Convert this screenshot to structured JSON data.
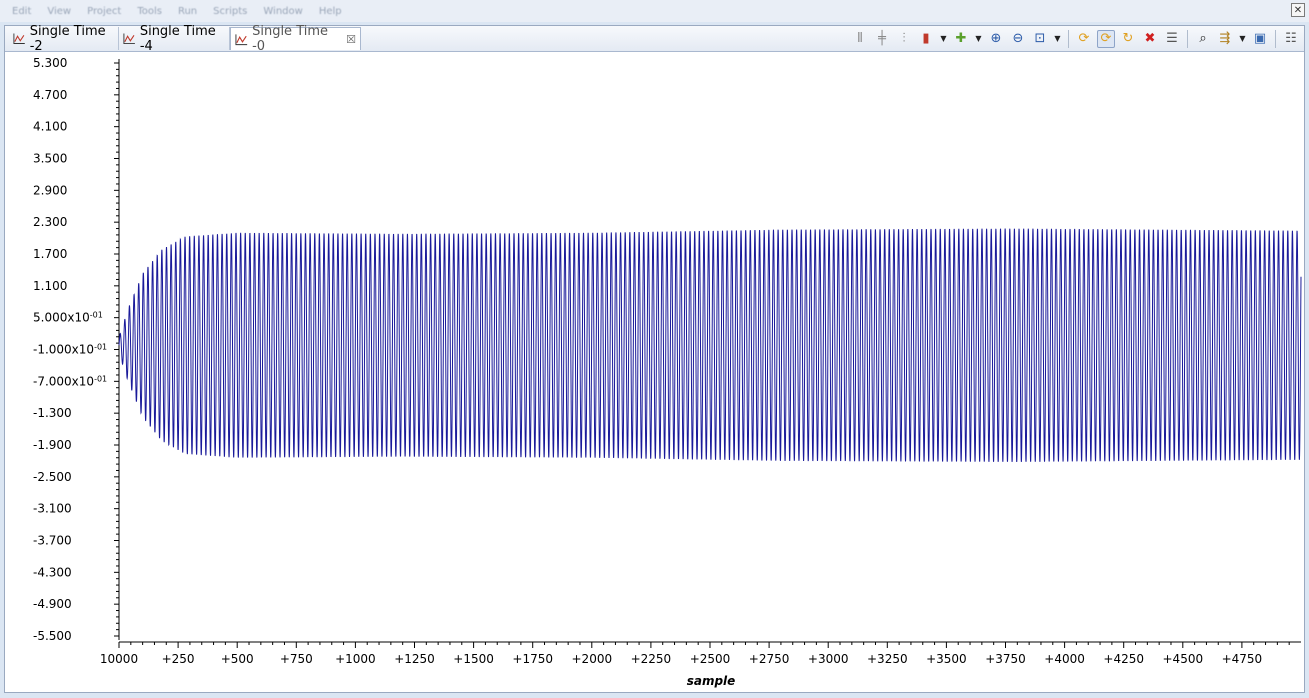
{
  "menubar": [
    "Edit",
    "View",
    "Project",
    "Tools",
    "Run",
    "Scripts",
    "Window",
    "Help"
  ],
  "tabs": [
    {
      "label": "Single Time -2",
      "active": false
    },
    {
      "label": "Single Time -4",
      "active": false
    },
    {
      "label": "Single Time -0",
      "active": true
    }
  ],
  "toolbar": [
    {
      "icon": "align-left-icon",
      "glyph": "⫴",
      "color": "#8a8a8a"
    },
    {
      "icon": "align-center-icon",
      "glyph": "╪",
      "color": "#8a8a8a"
    },
    {
      "icon": "align-right-icon",
      "glyph": "⫶",
      "color": "#8a8a8a"
    },
    {
      "icon": "marker-icon",
      "glyph": "▮",
      "color": "#c0392b",
      "dropdown": true
    },
    {
      "icon": "add-measurement-icon",
      "glyph": "✚",
      "color": "#5aa02c",
      "dropdown": true
    },
    {
      "icon": "zoom-in-icon",
      "glyph": "⊕",
      "color": "#2a5aa8"
    },
    {
      "icon": "zoom-out-icon",
      "glyph": "⊖",
      "color": "#2a5aa8"
    },
    {
      "icon": "zoom-fit-icon",
      "glyph": "⊡",
      "color": "#2a5aa8",
      "dropdown": true
    },
    {
      "sep": true
    },
    {
      "icon": "refresh-icon",
      "glyph": "⟳",
      "color": "#e0a020"
    },
    {
      "icon": "continuous-refresh-icon",
      "glyph": "⟳",
      "color": "#e0a020",
      "pressed": true
    },
    {
      "icon": "auto-refresh-icon",
      "glyph": "↻",
      "color": "#e0a020"
    },
    {
      "icon": "delete-icon",
      "glyph": "✖",
      "color": "#d02020"
    },
    {
      "icon": "properties-icon",
      "glyph": "☰",
      "color": "#555"
    },
    {
      "sep": true
    },
    {
      "icon": "find-icon",
      "glyph": "⌕",
      "color": "#222"
    },
    {
      "icon": "pin-icon",
      "glyph": "⇶",
      "color": "#b08020",
      "dropdown": true
    },
    {
      "icon": "save-icon",
      "glyph": "▣",
      "color": "#3a6ab0"
    },
    {
      "sep": true
    },
    {
      "icon": "view-menu-icon",
      "glyph": "☷",
      "color": "#555"
    }
  ],
  "window_close": "✕",
  "chart_data": {
    "type": "line",
    "xlabel": "sample",
    "ylabel": "",
    "line_color": "#1a1a9a",
    "x_start": 10000,
    "x_tick_labels": [
      "10000",
      "+250",
      "+500",
      "+750",
      "+1000",
      "+1250",
      "+1500",
      "+1750",
      "+2000",
      "+2250",
      "+2500",
      "+2750",
      "+3000",
      "+3250",
      "+3500",
      "+3750",
      "+4000",
      "+4250",
      "+4500",
      "+4750"
    ],
    "xlim": [
      0,
      5000
    ],
    "ylim": [
      -5.5,
      5.3
    ],
    "y_ticks": [
      5.3,
      4.7,
      4.1,
      3.5,
      2.9,
      2.3,
      1.7,
      1.1,
      0.5,
      -0.1,
      -0.7,
      -1.3,
      -1.9,
      -2.5,
      -3.1,
      -3.7,
      -4.3,
      -4.9,
      -5.5
    ],
    "y_tick_labels": [
      {
        "mantissa": "5.300",
        "exp": ""
      },
      {
        "mantissa": "4.700",
        "exp": ""
      },
      {
        "mantissa": "4.100",
        "exp": ""
      },
      {
        "mantissa": "3.500",
        "exp": ""
      },
      {
        "mantissa": "2.900",
        "exp": ""
      },
      {
        "mantissa": "2.300",
        "exp": ""
      },
      {
        "mantissa": "1.700",
        "exp": ""
      },
      {
        "mantissa": "1.100",
        "exp": ""
      },
      {
        "mantissa": "5.000x10",
        "exp": "-01"
      },
      {
        "mantissa": "-1.000x10",
        "exp": "-01"
      },
      {
        "mantissa": "-7.000x10",
        "exp": "-01"
      },
      {
        "mantissa": "-1.300",
        "exp": ""
      },
      {
        "mantissa": "-1.900",
        "exp": ""
      },
      {
        "mantissa": "-2.500",
        "exp": ""
      },
      {
        "mantissa": "-3.100",
        "exp": ""
      },
      {
        "mantissa": "-3.700",
        "exp": ""
      },
      {
        "mantissa": "-4.300",
        "exp": ""
      },
      {
        "mantissa": "-4.900",
        "exp": ""
      },
      {
        "mantissa": "-5.500",
        "exp": ""
      }
    ],
    "series": [
      {
        "signal": "oscillation",
        "period_samples": 19.6,
        "dc_offset": -0.02,
        "amplitude_envelope": [
          {
            "x": 0,
            "amp": 0.15
          },
          {
            "x": 40,
            "amp": 0.7
          },
          {
            "x": 100,
            "amp": 1.35
          },
          {
            "x": 180,
            "amp": 1.8
          },
          {
            "x": 280,
            "amp": 2.05
          },
          {
            "x": 500,
            "amp": 2.12
          },
          {
            "x": 1200,
            "amp": 2.1
          },
          {
            "x": 2000,
            "amp": 2.12
          },
          {
            "x": 2800,
            "amp": 2.18
          },
          {
            "x": 3800,
            "amp": 2.2
          },
          {
            "x": 4400,
            "amp": 2.18
          },
          {
            "x": 5000,
            "amp": 2.16
          }
        ]
      }
    ]
  }
}
